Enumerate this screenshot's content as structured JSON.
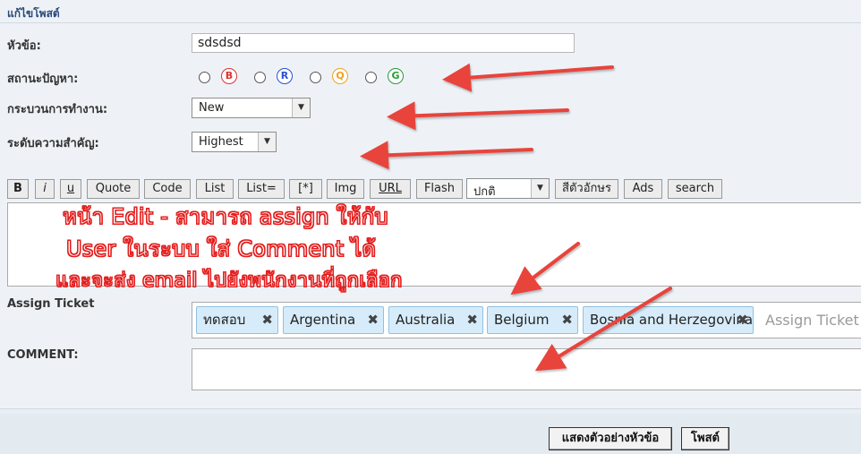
{
  "form": {
    "title": "แก้ไขโพสต์",
    "subject_label": "หัวข้อ:",
    "subject_value": "sdsdsd",
    "status_label": "สถานะปัญหา:",
    "status_options": [
      "B",
      "R",
      "Q",
      "G"
    ],
    "process_label": "กระบวนการทำงาน:",
    "process_value": "New",
    "priority_label": "ระดับความสำคัญ:",
    "priority_value": "Highest",
    "assign_label": "Assign Ticket",
    "assign_tags": [
      "ทดสอบ",
      "Argentina",
      "Australia",
      "Belgium",
      "Bosnia and Herzegovina"
    ],
    "assign_placeholder": "Assign Ticket",
    "comment_label": "COMMENT:"
  },
  "toolbar": {
    "bold": "B",
    "italic": "i",
    "underline": "u",
    "quote": "Quote",
    "code": "Code",
    "list": "List",
    "list_ordered": "List=",
    "list_item": "[*]",
    "img": "Img",
    "url": "URL",
    "flash": "Flash",
    "font_size": "ปกติ",
    "font_color": "สีตัวอักษร",
    "ads": "Ads",
    "search": "search"
  },
  "annotation": {
    "line1": "หน้า Edit  - สามารถ assign ให้กับ",
    "line2": "User ในระบบ ใส่ Comment ได้",
    "line3": "และจะส่ง email ไปยังพนักงานที่ถูกเลือก"
  },
  "actions": {
    "preview_label": "แสดงตัวอย่างหัวข้อ",
    "post_label": "โพสต์"
  },
  "colors": {
    "badge_b": "#e03030",
    "badge_r": "#2b4fd8",
    "badge_q": "#f0a020",
    "badge_g": "#2a9a3a",
    "annotation_red": "#e41d1d",
    "arrow_red": "#e8443c"
  }
}
